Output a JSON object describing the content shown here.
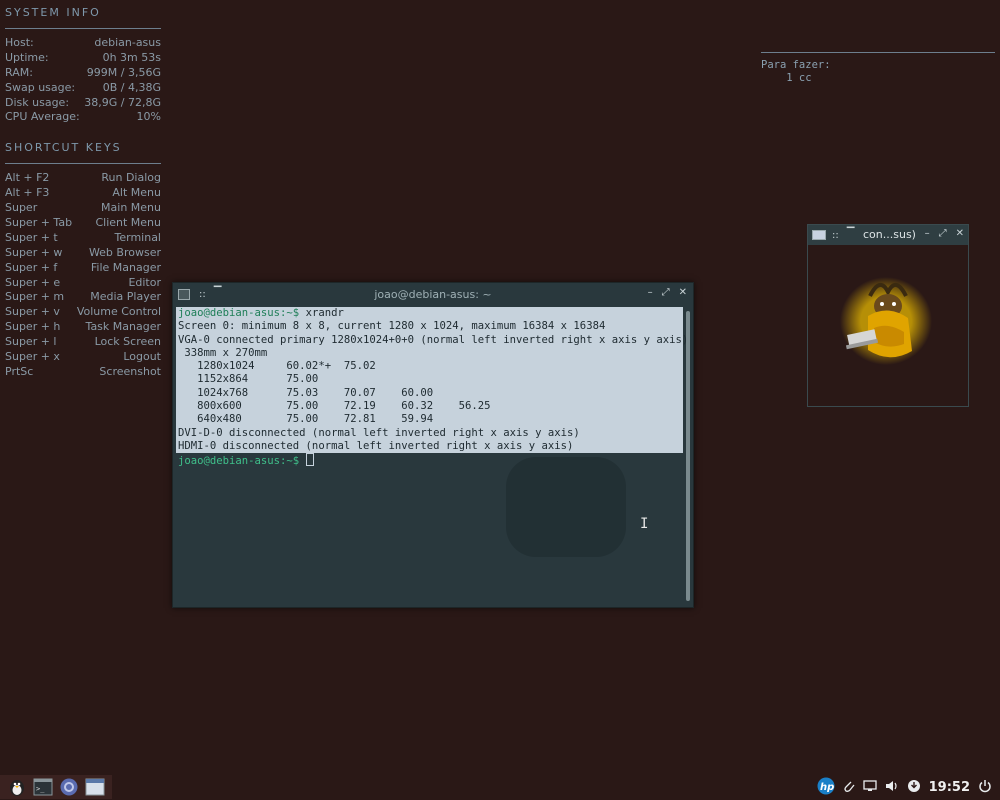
{
  "conky": {
    "system_header": "SYSTEM INFO",
    "system_rows": [
      {
        "label": "Host:",
        "value": "debian-asus"
      },
      {
        "label": "Uptime:",
        "value": "0h 3m 53s"
      },
      {
        "label": "RAM:",
        "value": "999M / 3,56G"
      },
      {
        "label": "Swap usage:",
        "value": "0B / 4,38G"
      },
      {
        "label": "Disk usage:",
        "value": "38,9G / 72,8G"
      },
      {
        "label": "CPU Average:",
        "value": "10%"
      }
    ],
    "shortcut_header": "SHORTCUT KEYS",
    "shortcuts": [
      {
        "keys": "Alt + F2",
        "action": "Run Dialog"
      },
      {
        "keys": "Alt + F3",
        "action": "Alt Menu"
      },
      {
        "keys": "Super",
        "action": "Main Menu"
      },
      {
        "keys": "Super + Tab",
        "action": "Client Menu"
      },
      {
        "keys": "Super + t",
        "action": "Terminal"
      },
      {
        "keys": "Super + w",
        "action": "Web Browser"
      },
      {
        "keys": "Super + f",
        "action": "File Manager"
      },
      {
        "keys": "Super + e",
        "action": "Editor"
      },
      {
        "keys": "Super + m",
        "action": "Media Player"
      },
      {
        "keys": "Super + v",
        "action": "Volume Control"
      },
      {
        "keys": "Super + h",
        "action": "Task Manager"
      },
      {
        "keys": "Super + l",
        "action": "Lock Screen"
      },
      {
        "keys": "Super + x",
        "action": "Logout"
      },
      {
        "keys": "PrtSc",
        "action": "Screenshot"
      }
    ]
  },
  "todo": {
    "title": "Para fazer:",
    "item": "    1 cc"
  },
  "terminal": {
    "title": "joao@debian-asus: ~",
    "prompt": "joao@debian-asus:~$",
    "command": "xrandr",
    "output": [
      "Screen 0: minimum 8 x 8, current 1280 x 1024, maximum 16384 x 16384",
      "VGA-0 connected primary 1280x1024+0+0 (normal left inverted right x axis y axis)",
      " 338mm x 270mm",
      "   1280x1024     60.02*+  75.02",
      "   1152x864      75.00",
      "   1024x768      75.03    70.07    60.00",
      "   800x600       75.00    72.19    60.32    56.25",
      "   640x480       75.00    72.81    59.94",
      "DVI-D-0 disconnected (normal left inverted right x axis y axis)",
      "HDMI-0 disconnected (normal left inverted right x axis y axis)"
    ]
  },
  "small_window": {
    "title": "con...sus)"
  },
  "taskbar": {
    "clock": "19:52",
    "tray_brand": "hp"
  },
  "colors": {
    "desktop": "#2a1816",
    "terminal_bg": "#29383d",
    "selection": "#c6d2dc",
    "prompt_green": "#3fbf8a"
  }
}
